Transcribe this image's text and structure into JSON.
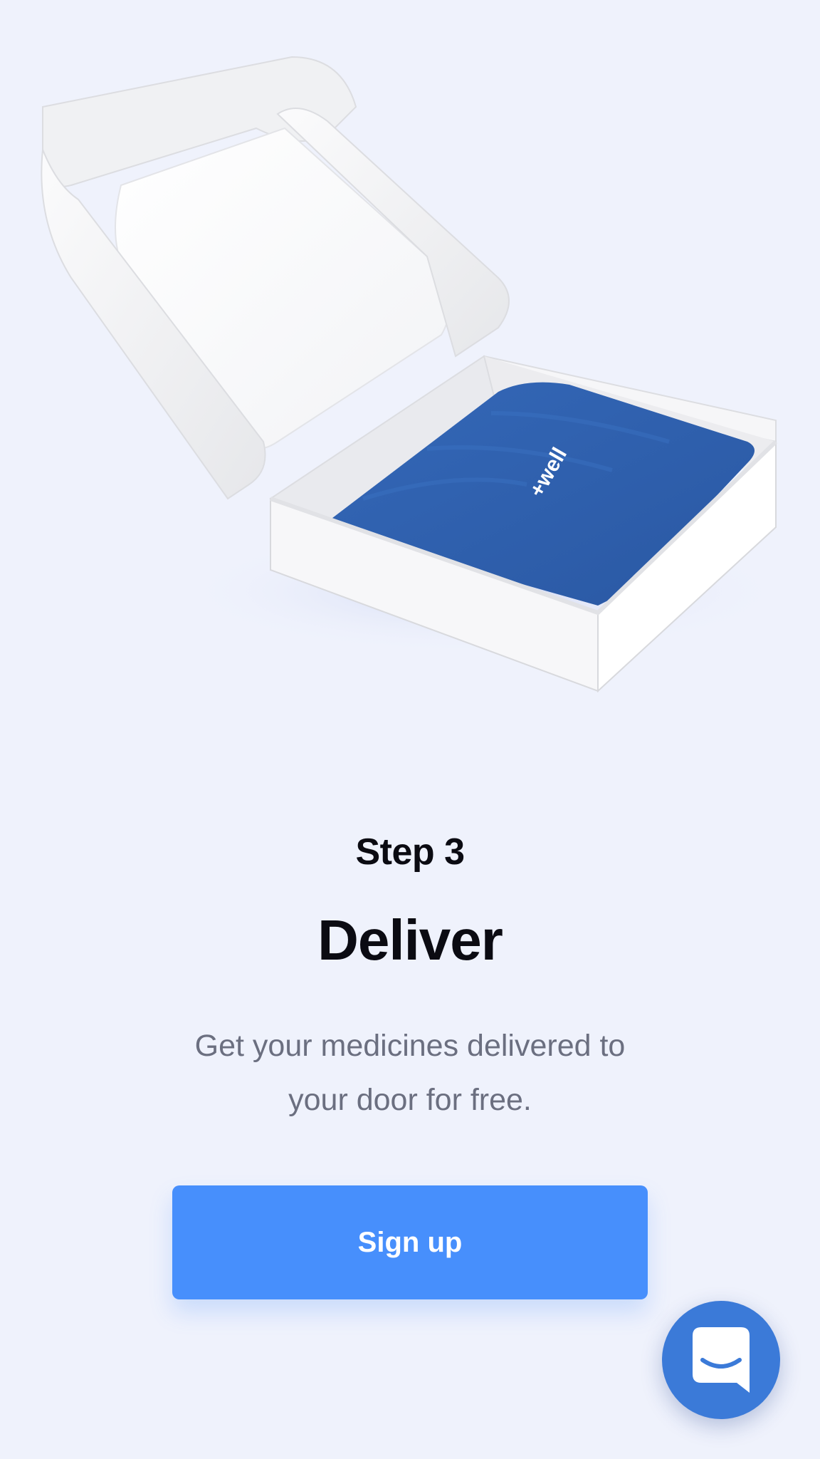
{
  "hero": {
    "image_alt": "Open white shipping box containing a blue package",
    "package_logo_text": "+well"
  },
  "step": {
    "label": "Step 3",
    "title": "Deliver",
    "description": "Get your medicines delivered to your door for free."
  },
  "cta": {
    "signup_label": "Sign up"
  },
  "chat": {
    "icon": "chat-bubble-smile-icon"
  },
  "colors": {
    "background": "#eff2fc",
    "button": "#478ffc",
    "chat_launcher": "#3b7ad8",
    "package": "#2f63b3"
  }
}
